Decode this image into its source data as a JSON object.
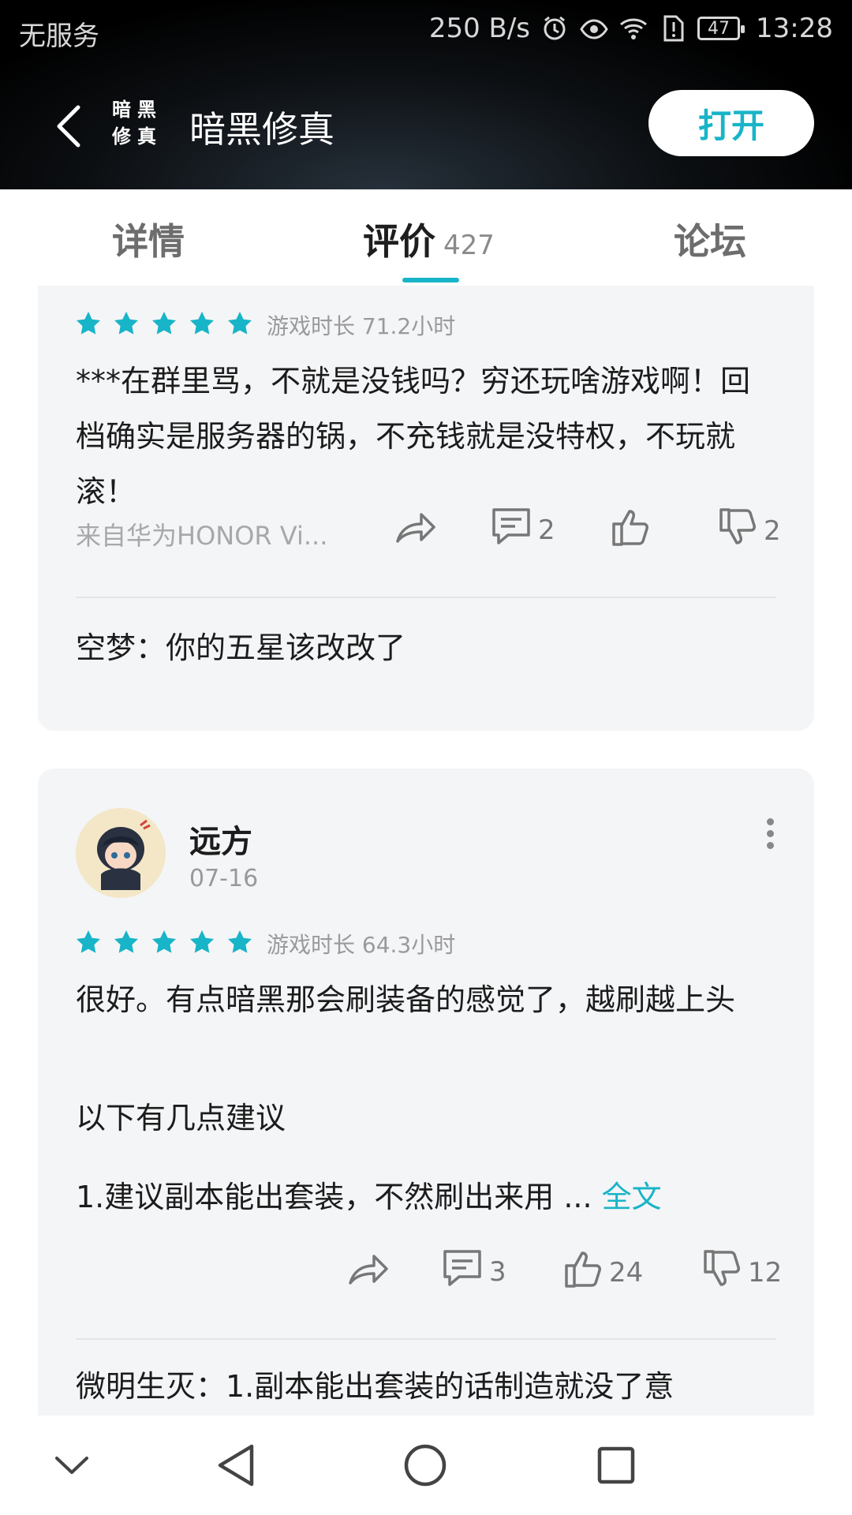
{
  "status_bar": {
    "carrier": "无服务",
    "speed": "250 B/s",
    "battery": "47",
    "time": "13:28"
  },
  "header": {
    "logo_text": "暗黑修真",
    "title": "暗黑修真",
    "open_label": "打开"
  },
  "tabs": [
    {
      "label": "详情"
    },
    {
      "label": "评价",
      "count": "427"
    },
    {
      "label": "论坛"
    }
  ],
  "reviews": [
    {
      "rating": 5,
      "playtime": "游戏时长 71.2小时",
      "body": "***在群里骂，不就是没钱吗？穷还玩啥游戏啊！回档确实是服务器的锅，不充钱就是没特权，不玩就滚！",
      "device": "来自华为HONOR Vi...",
      "comments": "2",
      "likes": "",
      "dislikes": "2",
      "reply": "空梦：你的五星该改改了"
    },
    {
      "user": "远方",
      "date": "07-16",
      "rating": 5,
      "playtime": "游戏时长 64.3小时",
      "body": "很好。有点暗黑那会刷装备的感觉了，越刷越上头",
      "body2": "以下有几点建议",
      "body3": "1.建议副本能出套装，不然刷出来用 ...",
      "fulltext_label": "全文",
      "comments": "3",
      "likes": "24",
      "dislikes": "12",
      "reply": "微明生灭：1.副本能出套装的话制造就没了意"
    }
  ],
  "colors": {
    "accent": "#18b4c7",
    "card_bg": "#f4f5f7",
    "header_bg": "#000000"
  }
}
